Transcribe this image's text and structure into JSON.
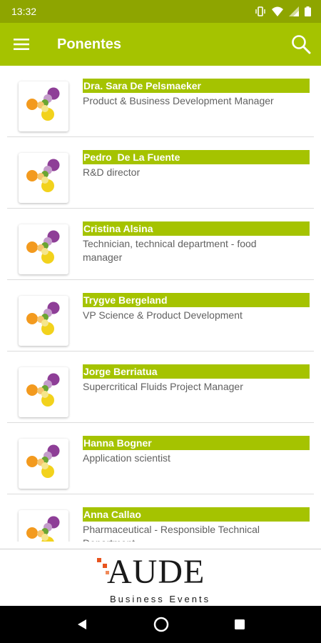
{
  "status_bar": {
    "time": "13:32"
  },
  "app_bar": {
    "title": "Ponentes"
  },
  "speakers": [
    {
      "name": "Dra. Sara De Pelsmaeker",
      "role": "Product & Business Development Manager"
    },
    {
      "name": "Pedro  De La Fuente",
      "role": "R&D director"
    },
    {
      "name": "Cristina Alsina",
      "role": "Technician, technical department -  food manager"
    },
    {
      "name": "Trygve Bergeland",
      "role": "VP Science & Product Development"
    },
    {
      "name": "Jorge Berriatua",
      "role": "Supercritical Fluids Project Manager"
    },
    {
      "name": "Hanna Bogner",
      "role": "Application scientist"
    },
    {
      "name": "Anna Callao",
      "role": "Pharmaceutical - Responsible Technical Department"
    }
  ],
  "banner": {
    "brand": "AUDE",
    "tagline": "Business Events"
  },
  "colors": {
    "primary": "#a5c300",
    "status": "#8ea500"
  },
  "icons": {
    "menu": "hamburger-menu-icon",
    "search": "search-icon",
    "back": "nav-back-icon",
    "home": "nav-home-icon",
    "recents": "nav-recents-icon"
  }
}
